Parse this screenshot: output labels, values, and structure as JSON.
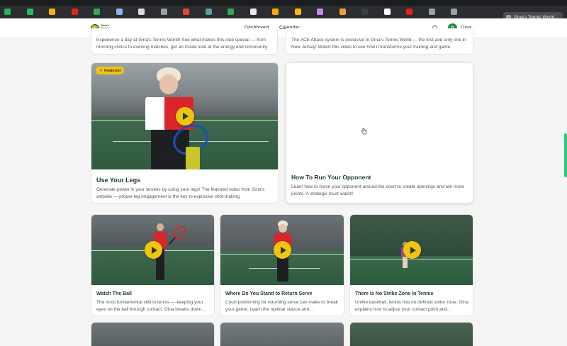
{
  "browser": {
    "active_tab_title": "Gina's Tennis World...",
    "tab_favicons": [
      {
        "name": "spotify",
        "color": "#1db954"
      },
      {
        "name": "k-app",
        "color": "#21c05e"
      },
      {
        "name": "notes",
        "color": "#f4b400"
      },
      {
        "name": "youtube",
        "color": "#e62117"
      },
      {
        "name": "maps",
        "color": "#34a853"
      },
      {
        "name": "doc",
        "color": "#8ab4f8"
      },
      {
        "name": "pages",
        "color": "#dadce0"
      },
      {
        "name": "k-doc",
        "color": "#9aa0a6"
      },
      {
        "name": "gmail",
        "color": "#ea4335"
      },
      {
        "name": "site",
        "color": "#5f9ea0"
      },
      {
        "name": "maps2",
        "color": "#34a853"
      },
      {
        "name": "blank",
        "color": "#e8eaed"
      },
      {
        "name": "chrome",
        "color": "#f9ab00"
      },
      {
        "name": "edit",
        "color": "#fbbc04"
      },
      {
        "name": "img",
        "color": "#c58af9"
      },
      {
        "name": "bear",
        "color": "#e8a33b"
      },
      {
        "name": "dark",
        "color": "#3c4043"
      },
      {
        "name": "github",
        "color": "#ffffff"
      },
      {
        "name": "youtube2",
        "color": "#e62117"
      },
      {
        "name": "mute",
        "color": "#9aa0a6"
      },
      {
        "name": "p-app",
        "color": "#9aa0a6"
      }
    ]
  },
  "header": {
    "logo_text": "Gina's Tennis World",
    "nav": [
      "Dashboard",
      "Calendar"
    ],
    "user_initial": "G",
    "user_name": "Gina"
  },
  "top_cards": [
    {
      "desc": "Experience a day at Gina's Tennis World! See what makes this club special — from morning clinics to evening matches, get an inside look at the energy and community."
    },
    {
      "desc": "The ACE Attack system is exclusive to Gina's Tennis World — the first and only one in New Jersey! Watch this video to see how it transforms your training and game."
    }
  ],
  "featured": {
    "badge": "Featured",
    "title": "Use Your Legs",
    "desc": "Generate power in your strokes by using your legs! The featured video from Gina's website — proper leg engagement is the key to explosive shot-making."
  },
  "opponent_card": {
    "title": "How To Run Your Opponent",
    "desc": "Learn how to move your opponent around the court to create openings and win more points. A strategic must-watch!"
  },
  "grid_cards": [
    {
      "title": "Watch The Ball",
      "desc": "The most fundamental skill in tennis — keeping your eyes on the ball through contact. Gina breaks down..."
    },
    {
      "title": "Where Do You Stand to Return Serve",
      "desc": "Court positioning for returning serve can make or break your game. Learn the optimal stance and..."
    },
    {
      "title": "There Is No Strike Zone In Tennis",
      "desc": "Unlike baseball, tennis has no defined strike zone. Gina explains how to adjust your contact point and..."
    }
  ],
  "colors": {
    "accent": "#f1c40f",
    "brand_green": "#1f3d22",
    "avatar": "#1d8a3c"
  }
}
